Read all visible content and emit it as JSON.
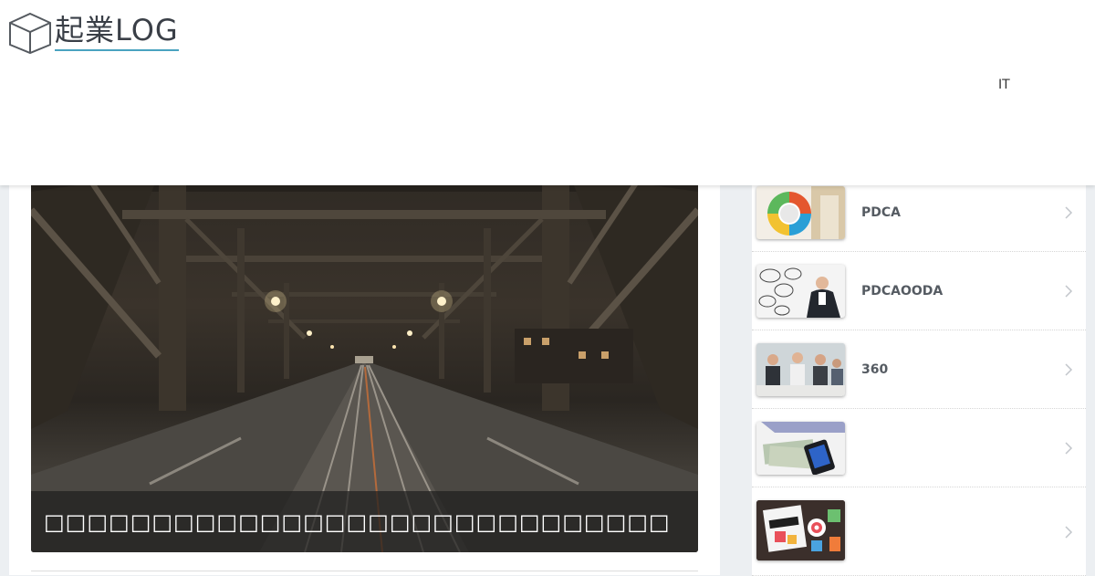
{
  "header": {
    "logo_text": "起業LOG",
    "nav_items": [
      {
        "label": "IT"
      }
    ]
  },
  "hero": {
    "title": "□□□□□□□□□□□□□□□□□□□□□□□□□□□□□"
  },
  "sidebar": {
    "items": [
      {
        "title": "PDCA",
        "thumb_icon": "pdca-cycle-image"
      },
      {
        "title": "PDCAOODA",
        "thumb_icon": "businessman-thinking-image"
      },
      {
        "title": "360",
        "thumb_icon": "office-meeting-image"
      },
      {
        "title": "",
        "thumb_icon": "money-and-phone-image"
      },
      {
        "title": "",
        "thumb_icon": "startup-collage-image"
      }
    ]
  },
  "colors": {
    "background": "#eceff2",
    "logo_underline": "#4aa3c0",
    "sidebar_text": "#555b62"
  }
}
